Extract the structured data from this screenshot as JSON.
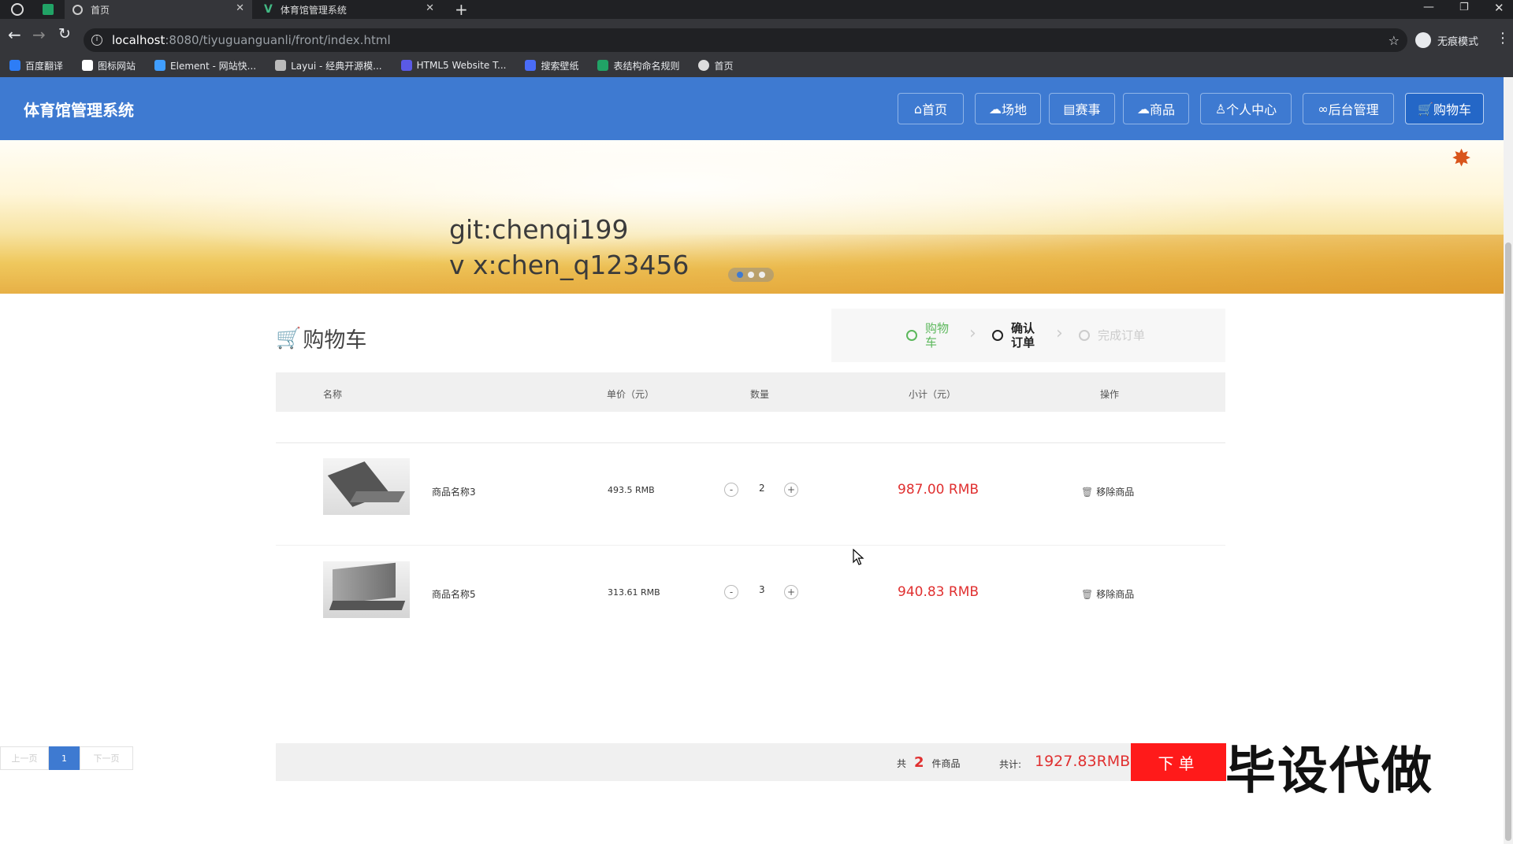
{
  "browser": {
    "tabs": [
      {
        "label": "首页"
      },
      {
        "label": "体育馆管理系统"
      }
    ],
    "url_host": "localhost",
    "url_rest": ":8080/tiyuguanguanli/front/index.html",
    "incognito_label": "无痕模式",
    "bookmarks": [
      {
        "label": "百度翻译",
        "color": "#2d7df6"
      },
      {
        "label": "图标网站",
        "color": "#ffffff"
      },
      {
        "label": "Element - 网站快...",
        "color": "#409eff"
      },
      {
        "label": "Layui - 经典开源模...",
        "color": "#bbbbbb"
      },
      {
        "label": "HTML5 Website T...",
        "color": "#5a5ae6"
      },
      {
        "label": "搜索壁纸",
        "color": "#4a6cf7"
      },
      {
        "label": "表结构命名规则",
        "color": "#21a366"
      },
      {
        "label": "首页",
        "color": "#dddddd"
      }
    ]
  },
  "site": {
    "title": "体育馆管理系统",
    "nav": [
      {
        "label": "首页",
        "icon": "home-icon"
      },
      {
        "label": "场地",
        "icon": "cloud-icon"
      },
      {
        "label": "赛事",
        "icon": "calendar-icon"
      },
      {
        "label": "商品",
        "icon": "cloud-icon"
      },
      {
        "label": "个人中心",
        "icon": "user-icon"
      },
      {
        "label": "后台管理",
        "icon": "link-icon"
      },
      {
        "label": "购物车",
        "icon": "cart-icon"
      }
    ],
    "active_nav": "购物车"
  },
  "banner": {
    "line1": "git:chenqi199",
    "line2": "v x:chen_q123456"
  },
  "cart": {
    "title": "购物车",
    "steps": [
      {
        "label": "购物车",
        "state": "done",
        "color": "#5cb85c"
      },
      {
        "label": "确认订单",
        "state": "current",
        "color": "#222222"
      },
      {
        "label": "完成订单",
        "state": "pending",
        "color": "#cccccc"
      }
    ],
    "columns": [
      "名称",
      "单价（元）",
      "数量",
      "小计（元）",
      "操作"
    ],
    "items": [
      {
        "name": "商品名称3",
        "price": "493.5 RMB",
        "qty": "2",
        "subtotal": "987.00 RMB",
        "remove": "移除商品"
      },
      {
        "name": "商品名称5",
        "price": "313.61 RMB",
        "qty": "3",
        "subtotal": "940.83 RMB",
        "remove": "移除商品"
      }
    ],
    "minus": "-",
    "plus": "+",
    "summary_prefix": "共",
    "summary_count": "2",
    "summary_suffix": "件商品",
    "total_label": "共计:",
    "total_value": "1927.83RMB",
    "order_button": "下单"
  },
  "pager": {
    "prev": "上一页",
    "current": "1",
    "next": "下一页"
  },
  "watermark": "毕设代做",
  "colors": {
    "primary": "#3e7ad1",
    "price_red": "#e03030",
    "order_red": "#ff1a1a"
  }
}
